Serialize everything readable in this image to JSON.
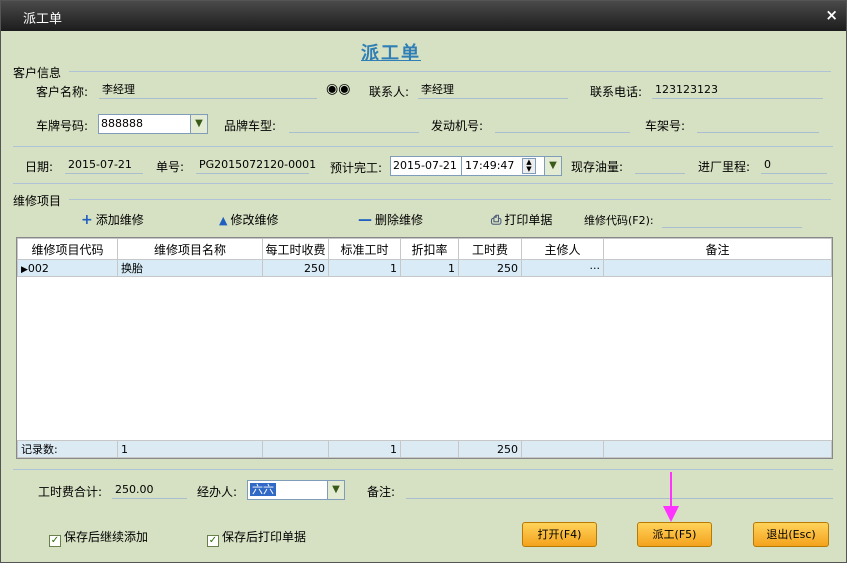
{
  "window": {
    "title": "派工单",
    "close_glyph": "×"
  },
  "form_title": "派工单",
  "customer": {
    "section_label": "客户信息",
    "name_label": "客户名称:",
    "name_value": "李经理",
    "contact_label": "联系人:",
    "contact_value": "李经理",
    "phone_label": "联系电话:",
    "phone_value": "123123123",
    "plate_label": "车牌号码:",
    "plate_value": "888888",
    "brand_label": "品牌车型:",
    "brand_value": "",
    "engine_label": "发动机号:",
    "engine_value": "",
    "frame_label": "车架号:",
    "frame_value": ""
  },
  "order": {
    "date_label": "日期:",
    "date_value": "2015-07-21",
    "no_label": "单号:",
    "no_value": "PG2015072120-0001",
    "finish_label": "预计完工:",
    "finish_date": "2015-07-21",
    "finish_time": "17:49:47",
    "fuel_label": "现存油量:",
    "fuel_value": "",
    "mileage_label": "进厂里程:",
    "mileage_value": "0"
  },
  "repair": {
    "section_label": "维修项目",
    "add_label": "添加维修",
    "edit_label": "修改维修",
    "delete_label": "删除维修",
    "print_label": "打印单据",
    "code_label": "维修代码(F2):",
    "code_value": "",
    "columns": [
      "维修项目代码",
      "维修项目名称",
      "每工时收费",
      "标准工时",
      "折扣率",
      "工时费",
      "主修人",
      "备注"
    ],
    "rows": [
      {
        "code": "002",
        "name": "换胎",
        "rate": "250",
        "hours": "1",
        "discount": "1",
        "fee": "250",
        "mechanic": "···",
        "note": ""
      }
    ],
    "footer": {
      "label": "记录数:",
      "count": "1",
      "hours": "1",
      "fee": "250"
    }
  },
  "summary": {
    "total_label": "工时费合计:",
    "total_value": "250.00",
    "handler_label": "经办人:",
    "handler_value": "六六",
    "note_label": "备注:",
    "note_value": ""
  },
  "options": {
    "continue_add": "保存后继续添加",
    "continue_add_checked": true,
    "print_after": "保存后打印单据",
    "print_after_checked": true
  },
  "buttons": {
    "open": "打开(F4)",
    "dispatch": "派工(F5)",
    "exit": "退出(Esc)"
  },
  "colors": {
    "accent": "#f4a21d",
    "annotation_arrow": "#ff33ff",
    "title": "#2f7fb6"
  }
}
